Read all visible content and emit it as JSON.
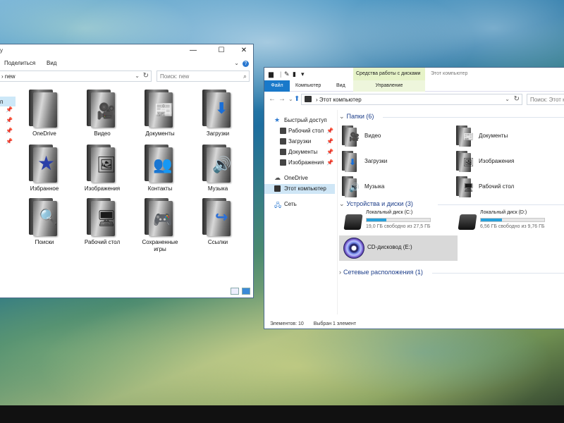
{
  "window_left": {
    "title_fragment": "y",
    "caption_buttons": {
      "minimize": "—",
      "maximize": "☐",
      "close": "✕"
    },
    "ribbon_tabs": [
      "Поделиться",
      "Вид"
    ],
    "help_badge": "?",
    "address": {
      "crumb": "new",
      "separator": "›"
    },
    "search": {
      "placeholder": "Поиск: new"
    },
    "nav": {
      "selected_fragment": "п"
    },
    "items": [
      {
        "label": "OneDrive",
        "badge": "☁",
        "badge_color": "#ffffff"
      },
      {
        "label": "Видео",
        "badge": "🎥",
        "badge_color": "#333333"
      },
      {
        "label": "Документы",
        "badge": "📰",
        "badge_color": "#2a6fb0"
      },
      {
        "label": "Загрузки",
        "badge": "⬇",
        "badge_color": "#1a6fd8"
      },
      {
        "label": "Избранное",
        "badge": "★",
        "badge_color": "#2a3fa8"
      },
      {
        "label": "Изображения",
        "badge": "🖼",
        "badge_color": "#4a8a3a"
      },
      {
        "label": "Контакты",
        "badge": "👥",
        "badge_color": "#2a4fc8"
      },
      {
        "label": "Музыка",
        "badge": "🔊",
        "badge_color": "#b08a20"
      },
      {
        "label": "Поиски",
        "badge": "🔍",
        "badge_color": "#4a7ac8"
      },
      {
        "label": "Рабочий стол",
        "badge": "🖥",
        "badge_color": "#2a8a3a"
      },
      {
        "label": "Сохраненные игры",
        "badge": "🎮",
        "badge_color": "#333333"
      },
      {
        "label": "Ссылки",
        "badge": "↪",
        "badge_color": "#2a6fd8"
      }
    ]
  },
  "window_right": {
    "qat_icons": [
      "folder-icon",
      "properties-icon",
      "new-folder-icon",
      "dropdown-icon"
    ],
    "context_group": "Средства работы с дисками",
    "title": "Этот компьютер",
    "tabs": {
      "file": "Файл",
      "computer": "Компьютер",
      "view": "Вид",
      "manage": "Управление"
    },
    "address": {
      "crumb": "Этот компьютер",
      "separator": "›"
    },
    "search": {
      "placeholder": "Поиск: Этот компьютер"
    },
    "nav": [
      {
        "label": "Быстрый доступ",
        "icon_color": "#2a78d0",
        "pinned": false,
        "indent": 0
      },
      {
        "label": "Рабочий стол",
        "icon_color": "#444444",
        "pinned": true,
        "indent": 1
      },
      {
        "label": "Загрузки",
        "icon_color": "#444444",
        "pinned": true,
        "indent": 1
      },
      {
        "label": "Документы",
        "icon_color": "#444444",
        "pinned": true,
        "indent": 1
      },
      {
        "label": "Изображения",
        "icon_color": "#444444",
        "pinned": true,
        "indent": 1
      },
      {
        "label": "OneDrive",
        "icon_color": "#555555",
        "pinned": false,
        "indent": 0
      },
      {
        "label": "Этот компьютер",
        "icon_color": "#333333",
        "pinned": false,
        "indent": 0,
        "selected": true
      },
      {
        "label": "Сеть",
        "icon_color": "#2a78d0",
        "pinned": false,
        "indent": 0
      }
    ],
    "groups": {
      "folders": "Папки (6)",
      "devices": "Устройства и диски (3)",
      "network": "Сетевые расположения (1)"
    },
    "folders": [
      {
        "label": "Видео",
        "badge": "🎥",
        "badge_color": "#333333"
      },
      {
        "label": "Документы",
        "badge": "📰",
        "badge_color": "#2a6fb0"
      },
      {
        "label": "Загрузки",
        "badge": "⬇",
        "badge_color": "#1a6fd8"
      },
      {
        "label": "Изображения",
        "badge": "🖼",
        "badge_color": "#4a8a3a"
      },
      {
        "label": "Музыка",
        "badge": "🔊",
        "badge_color": "#b08a20"
      },
      {
        "label": "Рабочий стол",
        "badge": "🖥",
        "badge_color": "#2a8a3a"
      }
    ],
    "drives": [
      {
        "name": "Локальный диск (C:)",
        "free": "19,0 ГБ свободно из 27,5 ГБ",
        "used_fraction": 0.31
      },
      {
        "name": "Локальный диск (D:)",
        "free": "6,56 ГБ свободно из 9,76 ГБ",
        "used_fraction": 0.33
      }
    ],
    "cd": {
      "name": "CD-дисковод (E:)"
    },
    "status": {
      "count": "Элементов: 10",
      "selected": "Выбран 1 элемент"
    }
  },
  "colors": {
    "accent": "#1979ca",
    "context_green": "#e6f3c8",
    "selection": "#cfe6f6",
    "group_header": "#1e3f8a"
  }
}
